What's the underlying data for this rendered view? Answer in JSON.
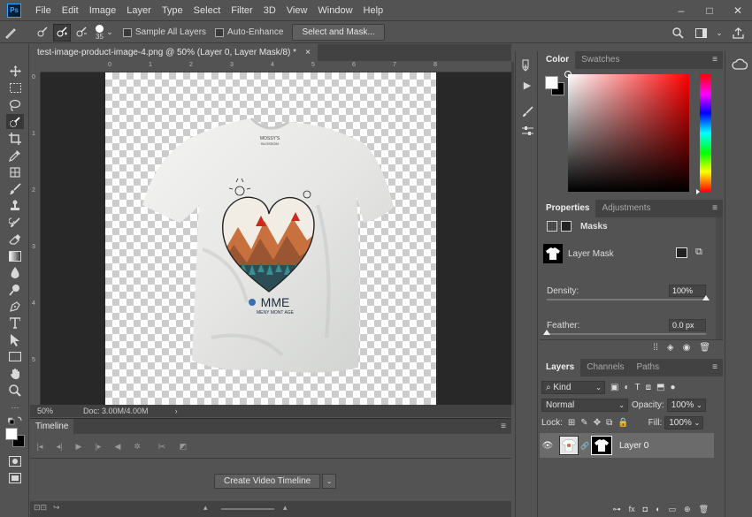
{
  "app": {
    "logo": "Ps"
  },
  "menu": [
    "File",
    "Edit",
    "Image",
    "Layer",
    "Type",
    "Select",
    "Filter",
    "3D",
    "View",
    "Window",
    "Help"
  ],
  "window_controls": {
    "minimize": "–",
    "maximize": "□",
    "close": "✕"
  },
  "options": {
    "brush_size": "35",
    "sample_all_layers": "Sample All Layers",
    "auto_enhance": "Auto-Enhance",
    "select_and_mask": "Select and Mask..."
  },
  "document": {
    "tab_title": "test-image-product-image-4.png @ 50% (Layer 0, Layer Mask/8) *",
    "close": "×",
    "ruler_top": [
      "0",
      "1",
      "2",
      "3",
      "4",
      "5",
      "6",
      "7",
      "8"
    ],
    "ruler_left": [
      "0",
      "1",
      "2",
      "3",
      "4",
      "5"
    ],
    "zoom": "50%",
    "doc_size": "Doc: 3.00M/4.00M",
    "status_arrow": "›"
  },
  "artwork": {
    "tag_top": "MOSSY'S",
    "tag_bottom": "BLOSSOM",
    "logo_text": "MME",
    "logo_sub": "MENY MONT AGE"
  },
  "timeline": {
    "tab": "Timeline",
    "create_button": "Create Video Timeline",
    "dropdown_arrow": "⌄"
  },
  "color_panel": {
    "tabs": [
      "Color",
      "Swatches"
    ],
    "fg": "#ffffff",
    "bg": "#000000"
  },
  "properties_panel": {
    "tabs": [
      "Properties",
      "Adjustments"
    ],
    "section": "Masks",
    "layer_mask_label": "Layer Mask",
    "density_label": "Density:",
    "density_value": "100%",
    "density_fraction": 1.0,
    "feather_label": "Feather:",
    "feather_value": "0.0 px",
    "feather_fraction": 0.0
  },
  "layers_panel": {
    "tabs": [
      "Layers",
      "Channels",
      "Paths"
    ],
    "filter_kind": "Kind",
    "blend_mode": "Normal",
    "opacity_label": "Opacity:",
    "opacity_value": "100%",
    "lock_label": "Lock:",
    "fill_label": "Fill:",
    "fill_value": "100%",
    "layers": [
      {
        "name": "Layer 0"
      }
    ]
  },
  "icons": {
    "panel_menu": "≡",
    "dropdown": "⌄",
    "eye": "👁"
  }
}
